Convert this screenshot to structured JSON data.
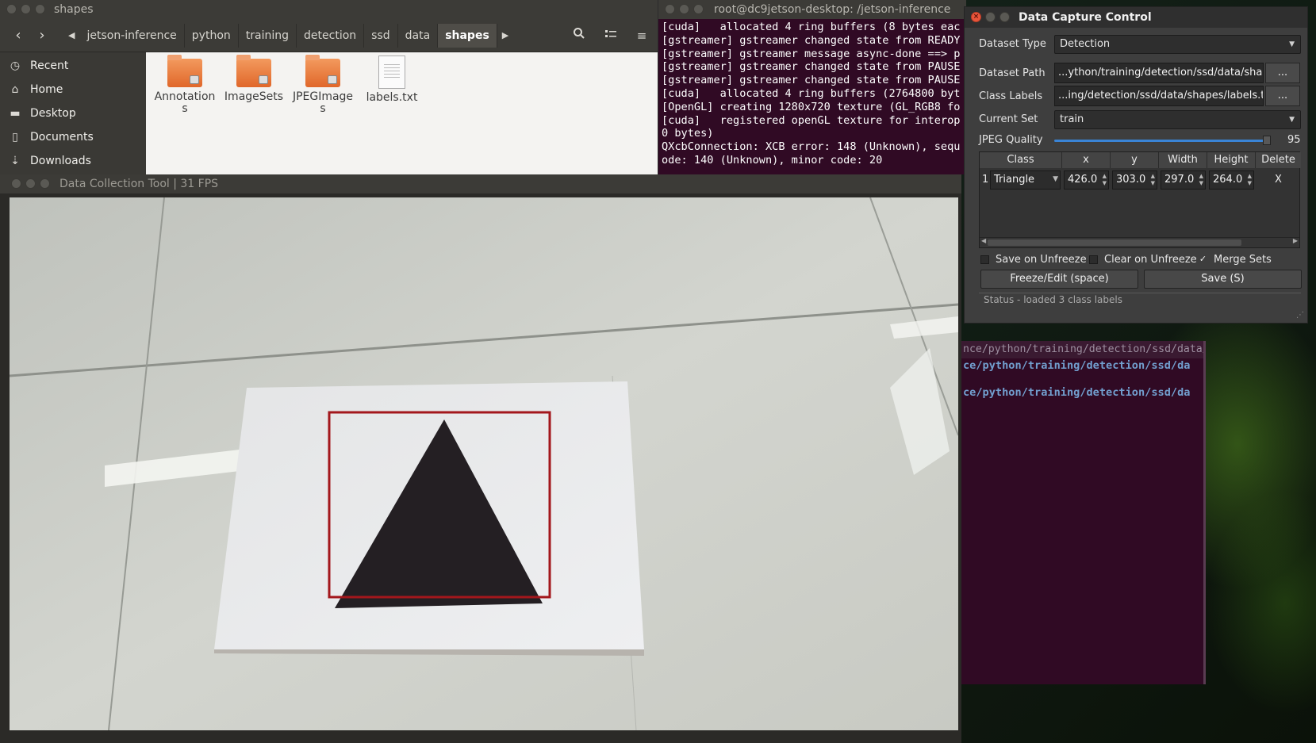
{
  "file_manager": {
    "title": "shapes",
    "breadcrumbs": [
      "jetson-inference",
      "python",
      "training",
      "detection",
      "ssd",
      "data",
      "shapes"
    ],
    "sidebar": [
      {
        "label": "Recent",
        "icon": "clock-icon"
      },
      {
        "label": "Home",
        "icon": "home-icon"
      },
      {
        "label": "Desktop",
        "icon": "desktop-folder-icon"
      },
      {
        "label": "Documents",
        "icon": "document-icon"
      },
      {
        "label": "Downloads",
        "icon": "download-icon"
      }
    ],
    "items": [
      {
        "line1": "Annotation",
        "line2": "s",
        "type": "folder"
      },
      {
        "line1": "ImageSets",
        "line2": "",
        "type": "folder"
      },
      {
        "line1": "JPEGImage",
        "line2": "s",
        "type": "folder"
      },
      {
        "line1": "labels.txt",
        "line2": "",
        "type": "file"
      }
    ]
  },
  "terminal": {
    "title": "root@dc9jetson-desktop: /jetson-inference",
    "lines": [
      "[cuda]   allocated 4 ring buffers (8 bytes eac",
      "[gstreamer] gstreamer changed state from READY",
      "[gstreamer] gstreamer message async-done ==> p",
      "[gstreamer] gstreamer changed state from PAUSE",
      "[gstreamer] gstreamer changed state from PAUSE",
      "[cuda]   allocated 4 ring buffers (2764800 byt",
      "[OpenGL] creating 1280x720 texture (GL_RGB8 fo",
      "[cuda]   registered openGL texture for interop",
      "0 bytes)",
      "QXcbConnection: XCB error: 148 (Unknown), sequ",
      "ode: 140 (Unknown), minor code: 20"
    ],
    "lower_gray": "nce/python/training/detection/ssd/data/sha",
    "lower_blue_1": "ce/python/training/detection/ssd/da",
    "lower_blue_2": "ce/python/training/detection/ssd/da"
  },
  "camera": {
    "title": "Data Collection Tool | 31 FPS"
  },
  "control": {
    "title": "Data Capture Control",
    "dataset_type_label": "Dataset Type",
    "dataset_type_value": "Detection",
    "dataset_path_label": "Dataset Path",
    "dataset_path_value": "...ython/training/detection/ssd/data/shapes",
    "class_labels_label": "Class Labels",
    "class_labels_value": "...ing/detection/ssd/data/shapes/labels.txt",
    "browse_label": "...",
    "current_set_label": "Current Set",
    "current_set_value": "train",
    "jpeg_quality_label": "JPEG Quality",
    "jpeg_quality_value": "95",
    "jpeg_quality_max": 100,
    "table_headers": [
      "Class",
      "x",
      "y",
      "Width",
      "Height",
      "Delete"
    ],
    "rows": [
      {
        "index": "1",
        "class": "Triangle",
        "x": "426.0",
        "y": "303.0",
        "width": "297.0",
        "height": "264.0",
        "delete": "X"
      }
    ],
    "save_on_unfreeze": "Save on Unfreeze",
    "clear_on_unfreeze": "Clear on Unfreeze",
    "merge_sets": "Merge Sets",
    "merge_check": "✓",
    "freeze_button": "Freeze/Edit (space)",
    "save_button": "Save (S)",
    "status": "Status - loaded 3 class labels"
  }
}
